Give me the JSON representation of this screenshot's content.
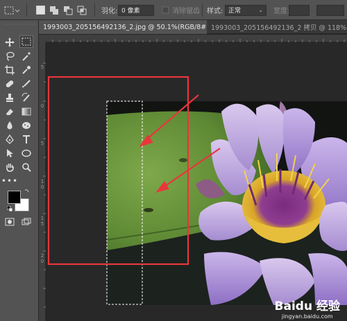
{
  "options_bar": {
    "feather_label": "羽化:",
    "feather_value": "0 像素",
    "antialias_label": "消除锯齿",
    "style_label": "样式:",
    "style_value": "正常",
    "width_label": "宽度:"
  },
  "tabs": [
    {
      "label": "1993003_205156492136_2.jpg @ 50.1%(RGB/8#) *",
      "close": "×"
    },
    {
      "label": "1993003_205156492136_2 拷贝 @ 118%(RGB"
    }
  ],
  "ruler_left_numbers": [
    "5",
    "0",
    "5",
    "1 0",
    "1 5",
    "2 0"
  ],
  "watermark": {
    "brand": "Baidu 经验",
    "url": "jingyan.baidu.com"
  },
  "colors": {
    "foreground": "#000000",
    "background": "#ffffff",
    "annotation_red": "#e8363b"
  }
}
